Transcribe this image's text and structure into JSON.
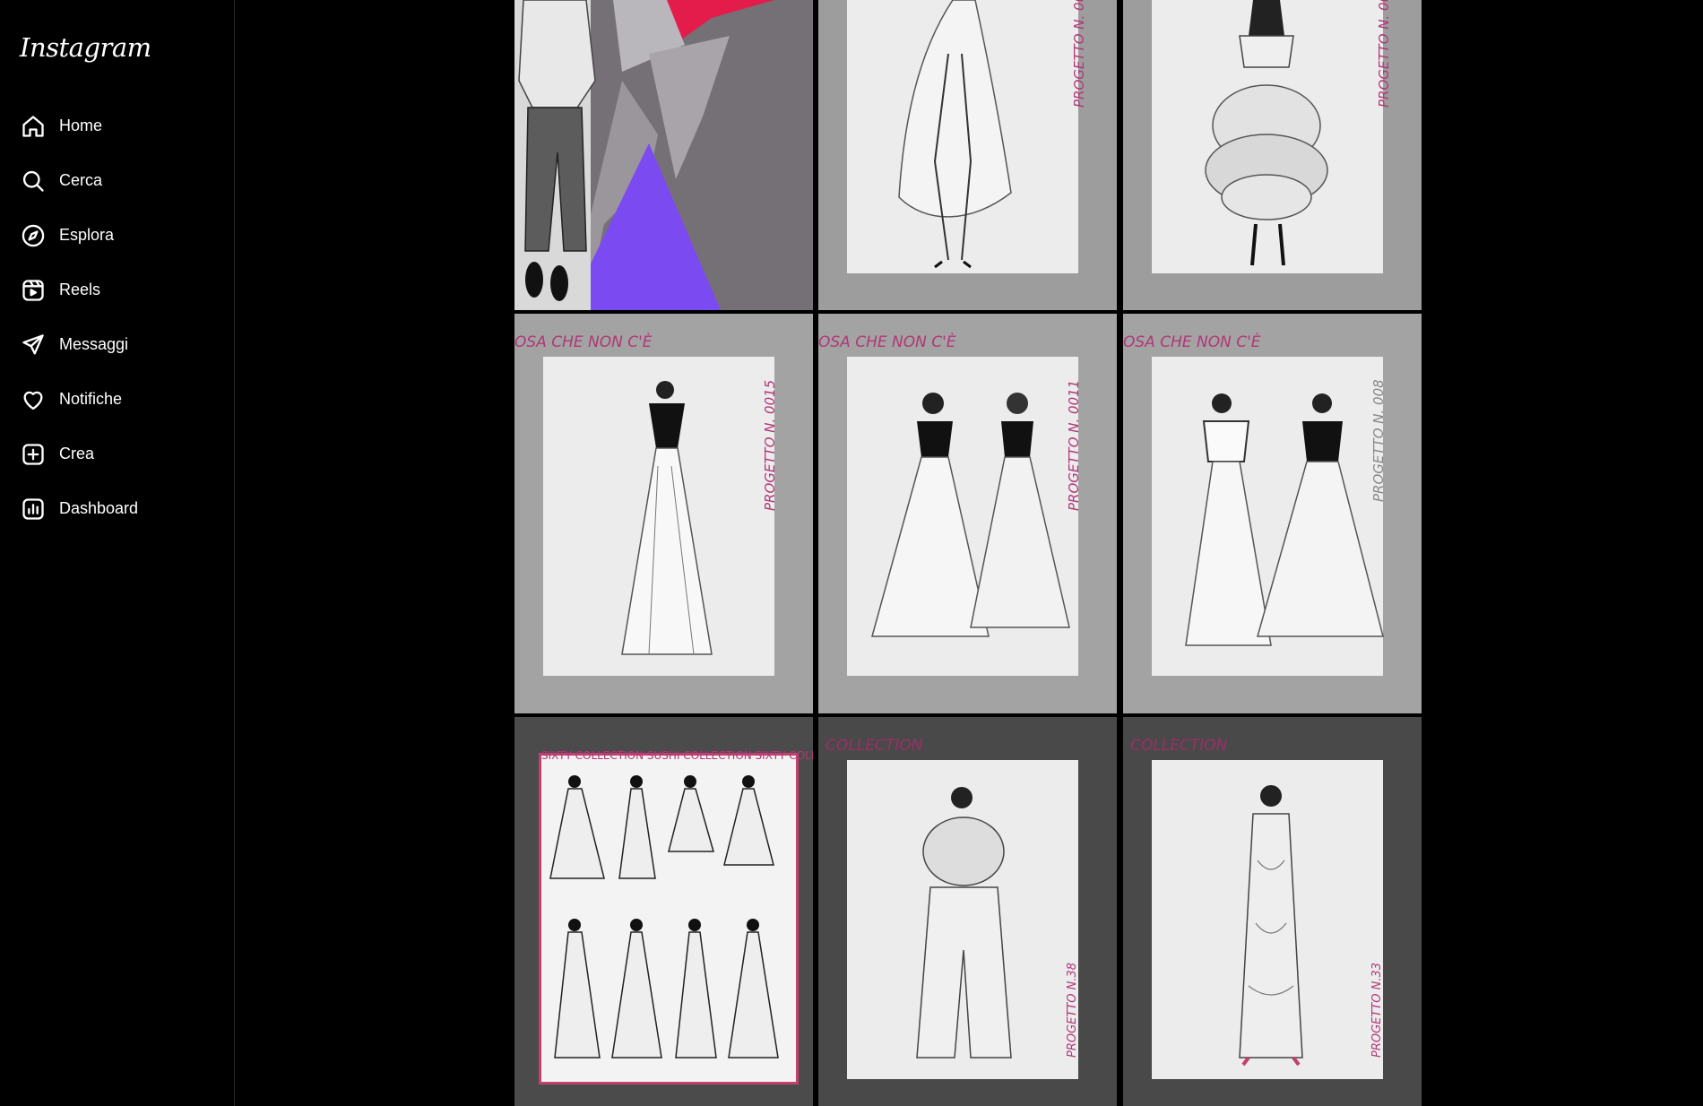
{
  "app": {
    "logo": "Instagram"
  },
  "sidebar": {
    "items": [
      {
        "label": "Home",
        "icon": "home-icon"
      },
      {
        "label": "Cerca",
        "icon": "search-icon"
      },
      {
        "label": "Esplora",
        "icon": "compass-icon"
      },
      {
        "label": "Reels",
        "icon": "reels-icon"
      },
      {
        "label": "Messaggi",
        "icon": "send-icon"
      },
      {
        "label": "Notifiche",
        "icon": "heart-icon"
      },
      {
        "label": "Crea",
        "icon": "plus-square-icon"
      },
      {
        "label": "Dashboard",
        "icon": "dashboard-icon"
      }
    ]
  },
  "posts": {
    "row0": [
      {
        "label": ""
      },
      {
        "label": "PROGETTO N. 00"
      },
      {
        "label": "PROGETTO N. 00"
      }
    ],
    "row1": [
      {
        "banner": "OSA CHE NON C'È",
        "label": "PROGETTO N. 0015"
      },
      {
        "banner": "OSA CHE NON C'È",
        "label": "PROGETTO N. 0011"
      },
      {
        "banner": "OSA CHE NON C'È",
        "label": "PROGETTO N. 008"
      }
    ],
    "row2": [
      {
        "border_text": "SIXTY COLLECTION SUSHI COLLECTION SIXTY COLLE"
      },
      {
        "banner": "COLLECTION",
        "label": "PROGETTO N.38"
      },
      {
        "banner": "COLLECTION",
        "label": "PROGETTO N.33"
      }
    ]
  },
  "colors": {
    "accent": "#b03777",
    "background": "#000000",
    "tile_gray": "#9a9a9a",
    "dark_tile": "#4a4949"
  }
}
